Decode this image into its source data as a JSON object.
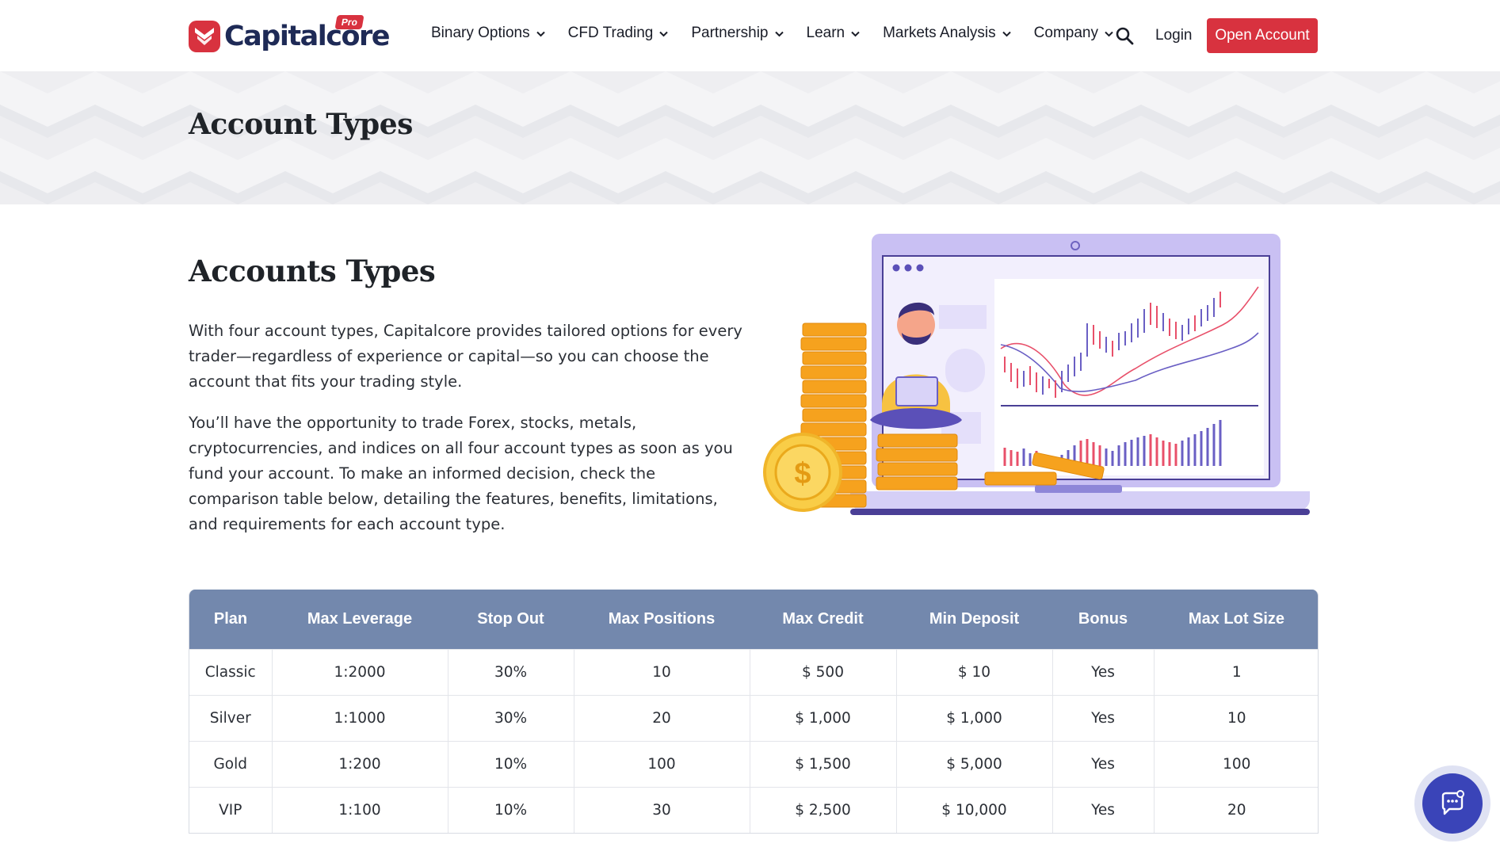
{
  "brand": {
    "name": "Capitalcore",
    "badge": "Pro",
    "accent": "#d8323f",
    "navy": "#1e2a56"
  },
  "nav": {
    "items": [
      {
        "label": "Binary Options"
      },
      {
        "label": "CFD Trading"
      },
      {
        "label": "Partnership"
      },
      {
        "label": "Learn"
      },
      {
        "label": "Markets Analysis"
      },
      {
        "label": "Company"
      }
    ],
    "login_label": "Login",
    "open_account_label": "Open Account"
  },
  "banner": {
    "title": "Account Types"
  },
  "content": {
    "title": "Accounts Types",
    "paragraph1": "With four account types, Capitalcore provides tailored options for every trader—regardless of experience or capital—so you can choose the account that fits your trading style.",
    "paragraph2": "You’ll have the opportunity to trade Forex, stocks, metals, cryptocurrencies, and indices on all four account types as soon as you fund your account. To make an informed decision, check the comparison table below, detailing the features, benefits, limitations, and requirements for each account type."
  },
  "table": {
    "header_color": "#7388ad",
    "headers": [
      "Plan",
      "Max Leverage",
      "Stop Out",
      "Max Positions",
      "Max Credit",
      "Min Deposit",
      "Bonus",
      "Max Lot Size"
    ],
    "rows": [
      [
        "Classic",
        "1:2000",
        "30%",
        "10",
        "$ 500",
        "$ 10",
        "Yes",
        "1"
      ],
      [
        "Silver",
        "1:1000",
        "30%",
        "20",
        "$ 1,000",
        "$ 1,000",
        "Yes",
        "10"
      ],
      [
        "Gold",
        "1:200",
        "10%",
        "100",
        "$ 1,500",
        "$ 5,000",
        "Yes",
        "100"
      ],
      [
        "VIP",
        "1:100",
        "10%",
        "30",
        "$ 2,500",
        "$ 10,000",
        "Yes",
        "20"
      ]
    ]
  },
  "illustration": {
    "coin_symbol": "$"
  },
  "icons": {
    "search": "search-icon",
    "chat": "chat-icon",
    "chevron": "chevron-down-icon"
  }
}
